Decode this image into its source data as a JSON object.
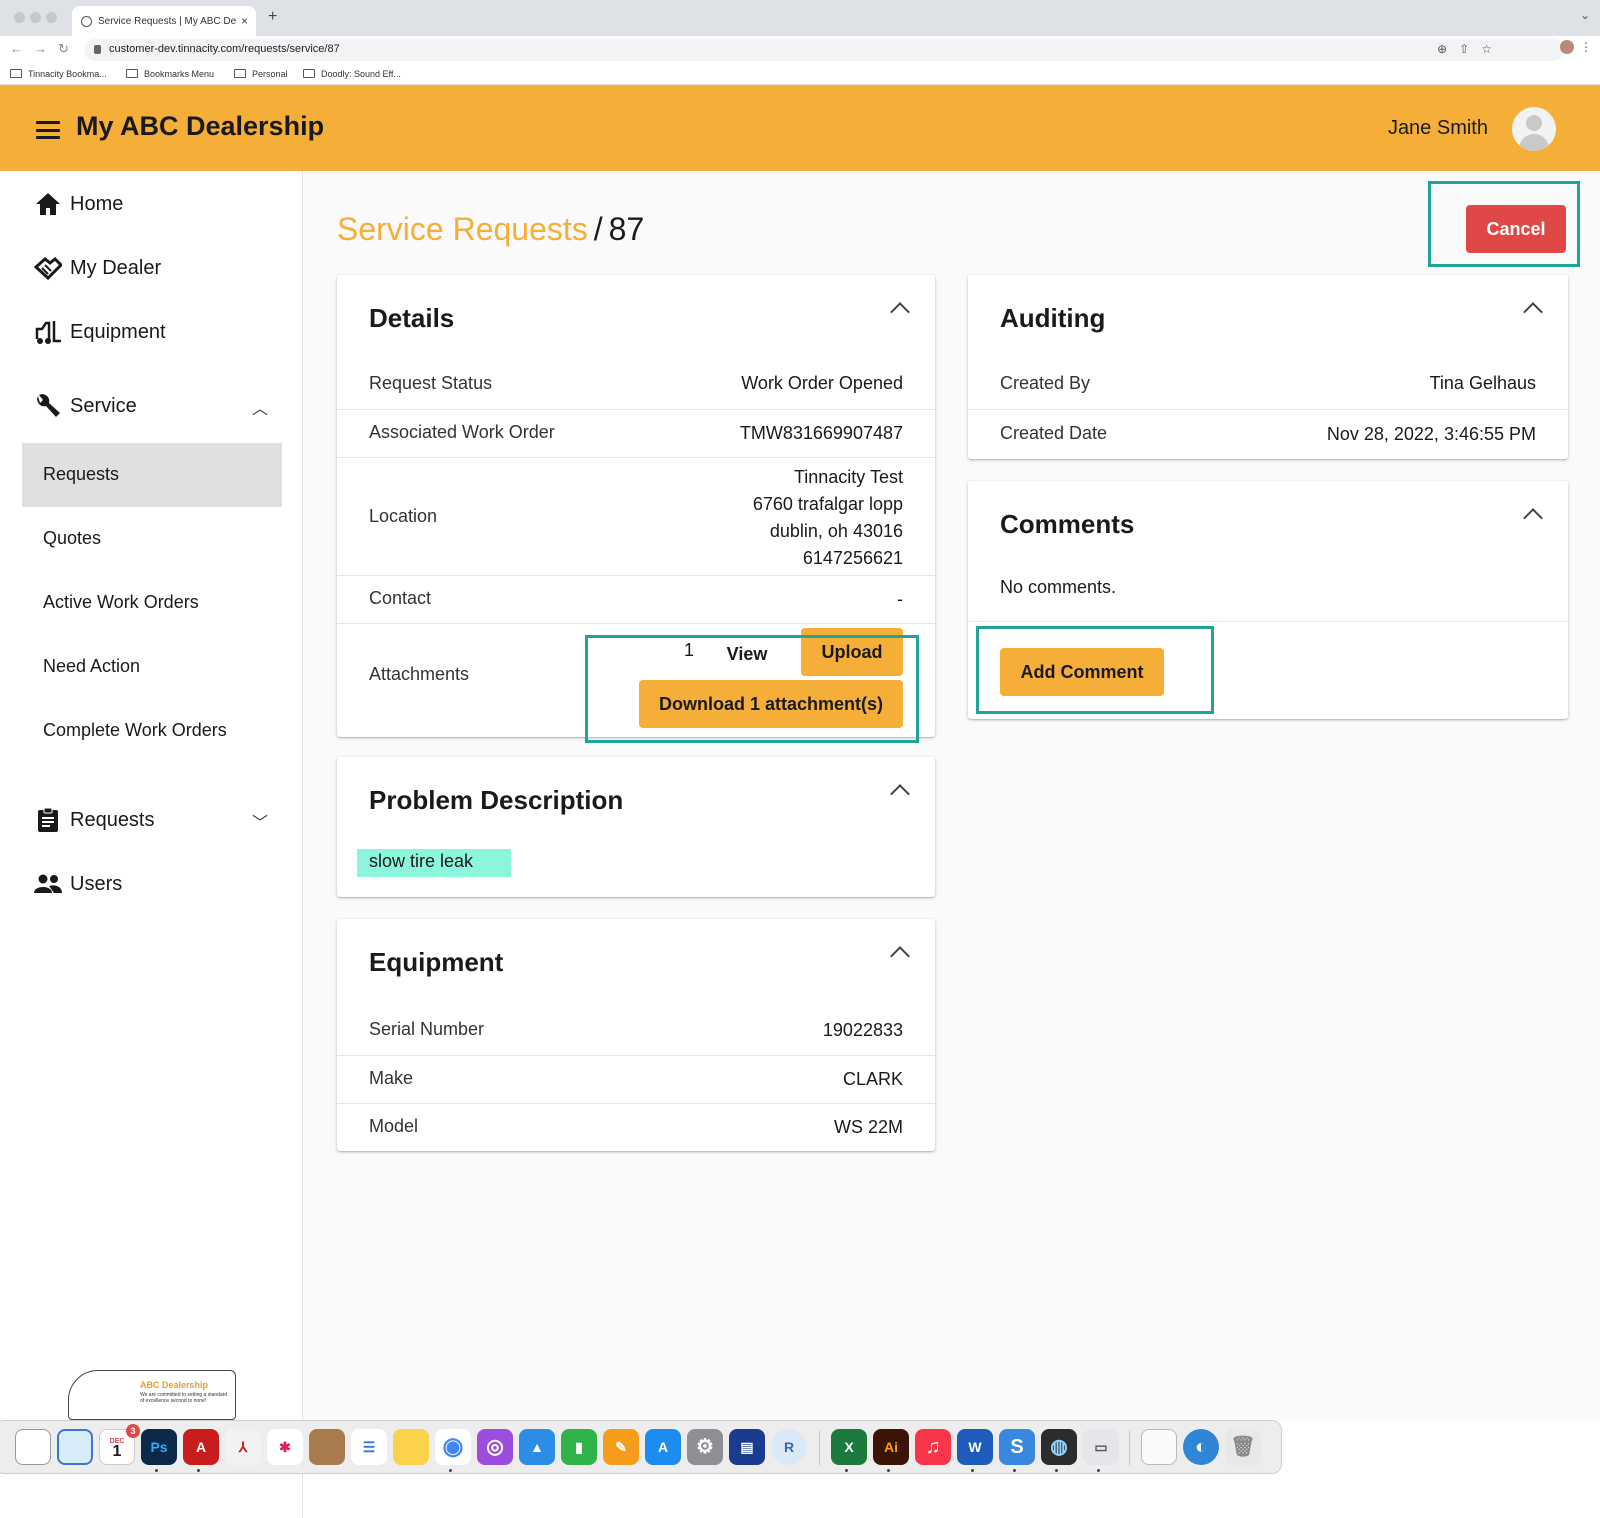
{
  "browser": {
    "tab_title": "Service Requests | My ABC De",
    "url": "customer-dev.tinnacity.com/requests/service/87",
    "bookmarks": [
      "Tinnacity Bookma...",
      "Bookmarks Menu",
      "Personal",
      "Doodly: Sound Eff..."
    ]
  },
  "header": {
    "brand": "My ABC Dealership",
    "user_name": "Jane Smith"
  },
  "sidebar": {
    "items": [
      {
        "label": "Home",
        "icon": "home-icon"
      },
      {
        "label": "My Dealer",
        "icon": "handshake-icon"
      },
      {
        "label": "Equipment",
        "icon": "forklift-icon"
      },
      {
        "label": "Service",
        "icon": "wrench-icon"
      },
      {
        "label": "Requests",
        "icon": "clipboard-icon"
      },
      {
        "label": "Users",
        "icon": "users-icon"
      }
    ],
    "service_sub": [
      "Requests",
      "Quotes",
      "Active Work Orders",
      "Need Action",
      "Complete Work Orders"
    ],
    "active_sub": "Requests",
    "logo": {
      "title": "ABC Dealership",
      "tagline": "We are committed to setting a standard of excellence second to none!"
    }
  },
  "breadcrumb": {
    "link": "Service Requests",
    "separator": "/",
    "current": "87"
  },
  "actions": {
    "cancel": "Cancel"
  },
  "details": {
    "title": "Details",
    "request_status_label": "Request Status",
    "request_status_value": "Work Order Opened",
    "work_order_label": "Associated Work Order",
    "work_order_value": "TMW831669907487",
    "location_label": "Location",
    "location_lines": [
      "Tinnacity Test",
      "6760 trafalgar lopp",
      "dublin, oh 43016",
      "6147256621"
    ],
    "contact_label": "Contact",
    "contact_value": "-",
    "attachments_label": "Attachments",
    "attachments_count": "1",
    "view_label": "View",
    "upload_label": "Upload",
    "download_label": "Download 1 attachment(s)"
  },
  "problem": {
    "title": "Problem Description",
    "text": "slow tire leak"
  },
  "equipment": {
    "title": "Equipment",
    "serial_label": "Serial Number",
    "serial_value": "19022833",
    "make_label": "Make",
    "make_value": "CLARK",
    "model_label": "Model",
    "model_value": "WS 22M"
  },
  "auditing": {
    "title": "Auditing",
    "created_by_label": "Created By",
    "created_by_value": "Tina Gelhaus",
    "created_date_label": "Created Date",
    "created_date_value": "Nov 28, 2022, 3:46:55 PM"
  },
  "comments": {
    "title": "Comments",
    "empty_text": "No comments.",
    "add_label": "Add Comment"
  },
  "dock": {
    "calendar_badge": "3",
    "calendar_month": "DEC",
    "calendar_day": "1",
    "apps": [
      {
        "name": "photoshop",
        "glyph": "Ps",
        "color": "#0b2a4a"
      },
      {
        "name": "acrobat",
        "glyph": "A",
        "color": "#c91d1d"
      },
      {
        "name": "illustrator",
        "glyph": "Ai",
        "color": "#3a1507"
      },
      {
        "name": "word",
        "glyph": "W",
        "color": "#1f5bb8"
      },
      {
        "name": "excel",
        "glyph": "X",
        "color": "#1c7a3e"
      }
    ]
  },
  "colors": {
    "accent": "#f5ae38",
    "cancel": "#e04848",
    "highlight_box": "#21a497",
    "text_highlight": "#8bf5dd"
  }
}
